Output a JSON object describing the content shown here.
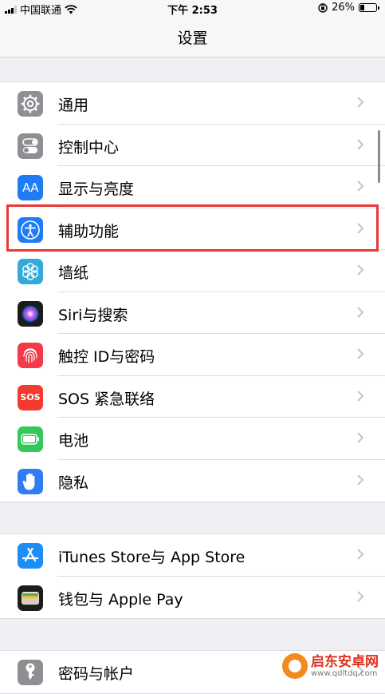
{
  "status_bar": {
    "carrier": "中国联通",
    "time": "下午 2:53",
    "battery_pct": "26%",
    "battery_level": 0.26
  },
  "nav": {
    "title": "设置"
  },
  "groups": [
    {
      "items": [
        {
          "label": "通用",
          "icon": "gear-icon",
          "color": "#8e8e93"
        },
        {
          "label": "控制中心",
          "icon": "toggles-icon",
          "color": "#8e8e93"
        },
        {
          "label": "显示与亮度",
          "icon": "text-size-icon",
          "color": "#1f7cf6",
          "icon_text": "AA"
        },
        {
          "label": "辅助功能",
          "icon": "accessibility-icon",
          "color": "#1f7cf6"
        },
        {
          "label": "墙纸",
          "icon": "flower-icon",
          "color": "#34aadc"
        },
        {
          "label": "Siri与搜索",
          "icon": "siri-icon",
          "color": "#1c1c1e"
        },
        {
          "label": "触控 ID与密码",
          "icon": "fingerprint-icon",
          "color": "#f23a48"
        },
        {
          "label": "SOS 紧急联络",
          "icon": "sos-icon",
          "color": "#f23a30",
          "icon_text": "SOS"
        },
        {
          "label": "电池",
          "icon": "battery-icon",
          "color": "#34c759"
        },
        {
          "label": "隐私",
          "icon": "hand-icon",
          "color": "#2f7cf6"
        }
      ]
    },
    {
      "items": [
        {
          "label": "iTunes Store与 App Store",
          "icon": "app-store-icon",
          "color": "#1c8ef5"
        },
        {
          "label": "钱包与 Apple Pay",
          "icon": "wallet-icon",
          "color": "#1c1c1e"
        }
      ]
    },
    {
      "items": [
        {
          "label": "密码与帐户",
          "icon": "key-icon",
          "color": "#8e8e93"
        }
      ]
    }
  ],
  "highlight_color": "#e8393a",
  "watermark": {
    "brand": "启东安卓网",
    "url": "www.qdltdq.com"
  }
}
